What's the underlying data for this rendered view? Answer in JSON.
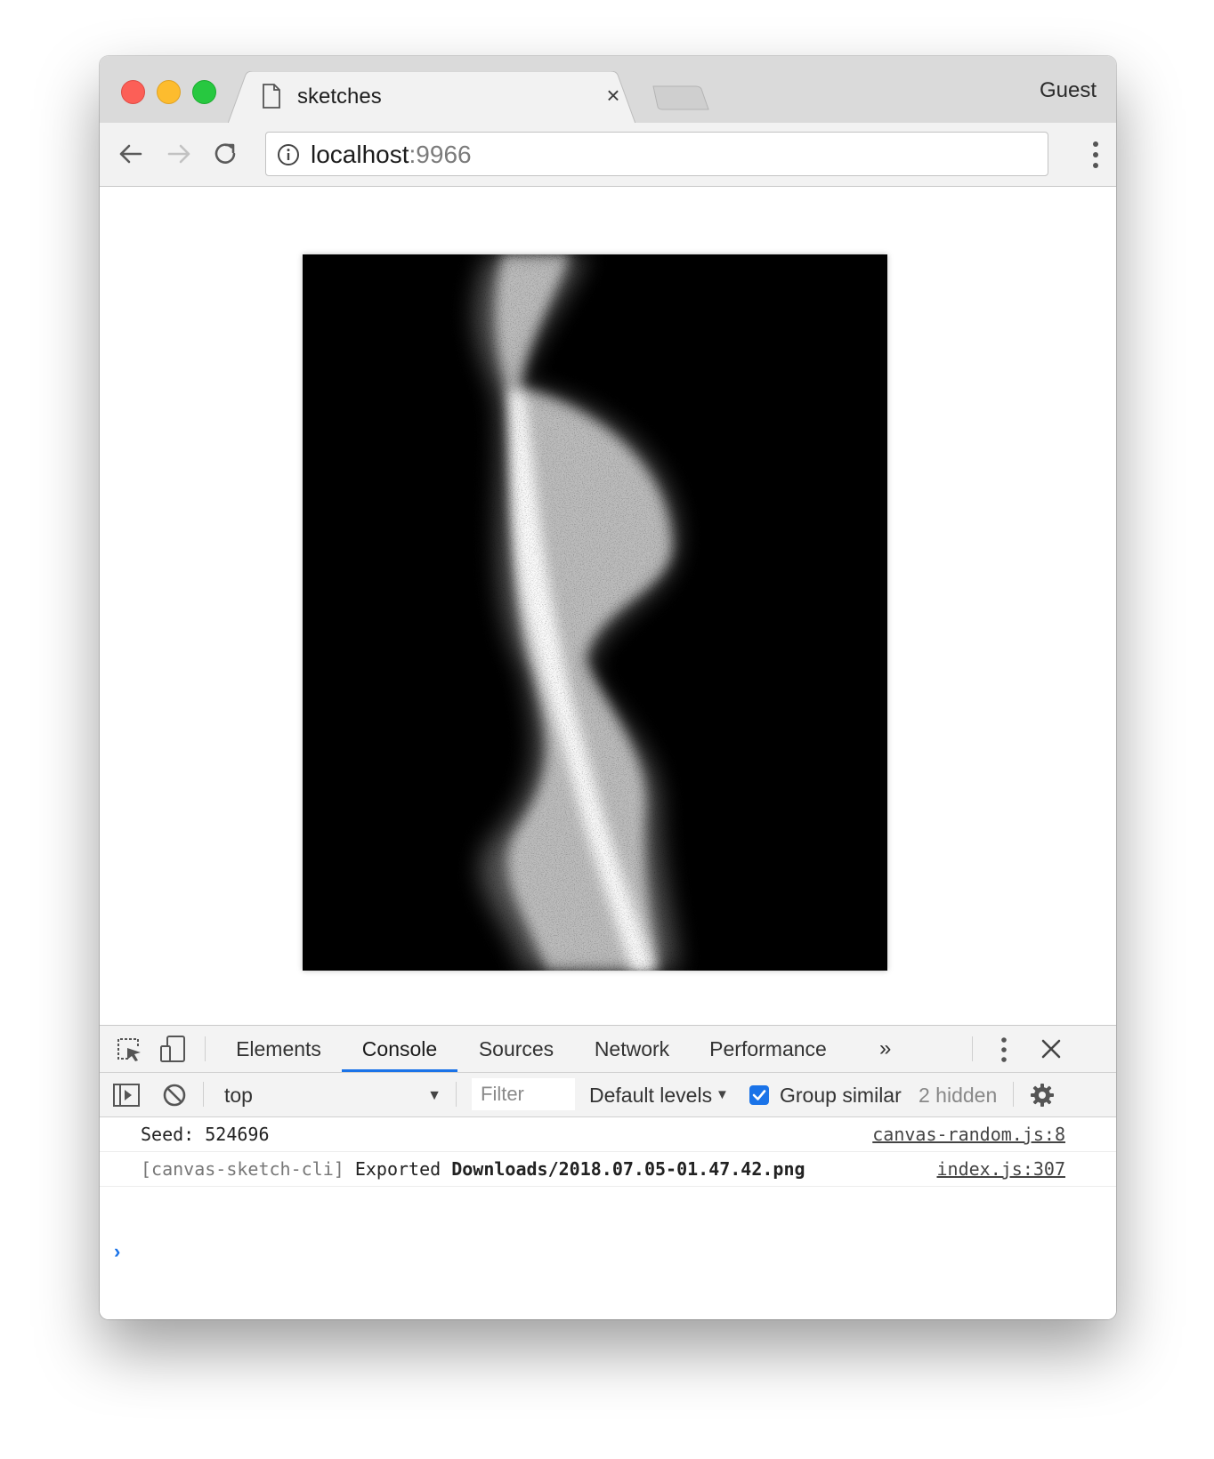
{
  "browser": {
    "tab_title": "sketches",
    "tab_close": "×",
    "profile": "Guest",
    "url_host": "localhost",
    "url_port": ":9966"
  },
  "devtools": {
    "tabs": [
      "Elements",
      "Console",
      "Sources",
      "Network",
      "Performance"
    ],
    "active_tab": "Console",
    "more_tabs": "»",
    "context": "top",
    "filter_placeholder": "Filter",
    "levels": "Default levels",
    "group_similar_label": "Group similar",
    "group_similar_checked": true,
    "hidden_count": "2 hidden",
    "accent": "#1a73e8"
  },
  "console": {
    "seed_text": "Seed: 524696",
    "seed_source": "canvas-random.js:8",
    "export_prefix": "[canvas-sketch-cli]",
    "export_word": "Exported",
    "export_path": "Downloads/2018.07.05-01.47.42.png",
    "export_source": "index.js:307",
    "prompt": "›"
  }
}
